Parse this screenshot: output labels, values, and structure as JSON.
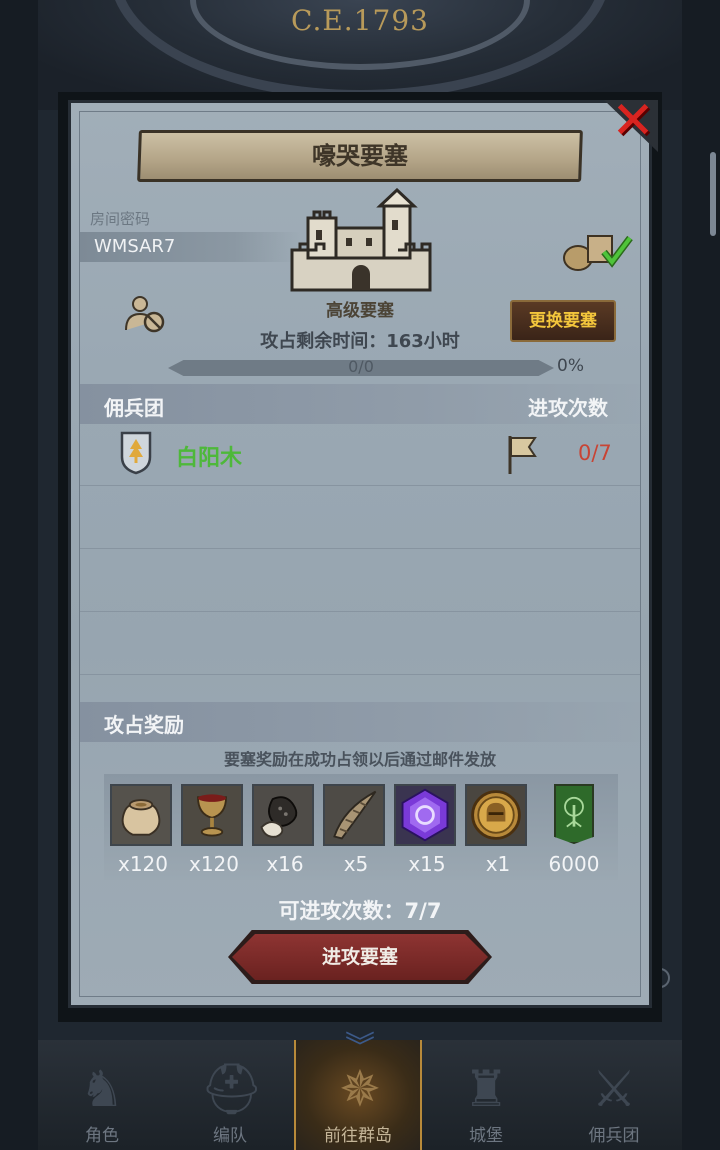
{
  "header": {
    "era": "C.E.1793"
  },
  "dialog": {
    "title": "嚎哭要塞",
    "room_password_label": "房间密码",
    "room_password": "WMSAR7",
    "fortress_grade": "高级要塞",
    "change_fortress_button": "更换要塞",
    "time_left": "攻占剩余时间：163小时",
    "progress": {
      "text": "0/0",
      "percent_text": "0%",
      "fraction": 0
    },
    "mercenary_header": "佣兵团",
    "attack_count_header": "进攻次数",
    "guild": {
      "name": "白阳木",
      "attacks": "0/7"
    },
    "rewards_header": "攻占奖励",
    "rewards_note": "要塞奖励在成功占领以后通过邮件发放",
    "rewards": [
      {
        "icon": "sack-icon",
        "qty": "x120"
      },
      {
        "icon": "goblet-icon",
        "qty": "x120"
      },
      {
        "icon": "ore-icon",
        "qty": "x16"
      },
      {
        "icon": "horn-icon",
        "qty": "x5"
      },
      {
        "icon": "purple-crystal-icon",
        "qty": "x15"
      },
      {
        "icon": "knight-helmet-coin-icon",
        "qty": "x1"
      },
      {
        "icon": "green-tree-banner-icon",
        "qty": "6000"
      }
    ],
    "remaining_attacks": "可进攻次数：7/7",
    "attack_button": "进攻要塞"
  },
  "bottom_nav": [
    {
      "label": "角色",
      "icon": "knight-icon",
      "active": false
    },
    {
      "label": "编队",
      "icon": "helmet-icon",
      "active": false
    },
    {
      "label": "前往群岛",
      "icon": "compass-icon",
      "active": true
    },
    {
      "label": "城堡",
      "icon": "castle-icon",
      "active": false
    },
    {
      "label": "佣兵团",
      "icon": "mercenary-icon",
      "active": false
    }
  ],
  "colors": {
    "guild_name": "#4eb83a",
    "attack_count": "#c84434",
    "change_button_text": "#f3c63c",
    "close_x": "#d82420"
  }
}
